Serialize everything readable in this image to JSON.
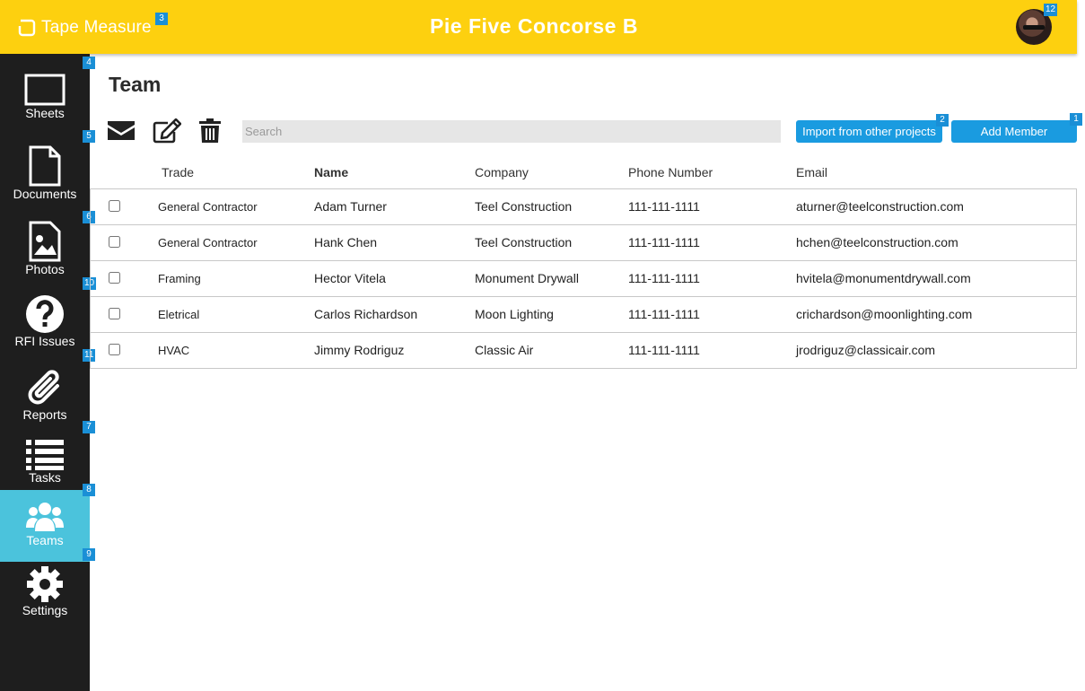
{
  "header": {
    "logo_text": "Tape Measure",
    "project_title": "Pie Five Concorse B",
    "brand_color": "#fdd00f"
  },
  "badges": {
    "add_member": "1",
    "import": "2",
    "logo": "3",
    "sidebar_top": "4",
    "toolbar": "5",
    "row_one": "6",
    "reports": "7",
    "teams": "8",
    "settings": "9",
    "row_three": "10",
    "row_five": "11",
    "avatar": "12"
  },
  "sidebar": {
    "items": [
      {
        "label": "Sheets",
        "icon": "sheet-icon"
      },
      {
        "label": "Documents",
        "icon": "document-icon"
      },
      {
        "label": "Photos",
        "icon": "photo-icon"
      },
      {
        "label": "RFI Issues",
        "icon": "question-icon"
      },
      {
        "label": "Reports",
        "icon": "paperclip-icon"
      },
      {
        "label": "Tasks",
        "icon": "list-icon"
      },
      {
        "label": "Teams",
        "icon": "users-icon",
        "active": true
      },
      {
        "label": "Settings",
        "icon": "gear-icon"
      }
    ],
    "active_color": "#4bc3dc"
  },
  "page": {
    "title": "Team",
    "search_placeholder": "Search",
    "import_label": "Import from other projects",
    "add_member_label": "Add Member",
    "accent_color": "#1a9be0"
  },
  "table": {
    "columns": [
      "Trade",
      "Name",
      "Company",
      "Phone Number",
      "Email"
    ],
    "rows": [
      {
        "trade": "General Contractor",
        "name": "Adam Turner",
        "company": "Teel Construction",
        "phone": "111-111-1111",
        "email": "aturner@teelconstruction.com"
      },
      {
        "trade": "General Contractor",
        "name": "Hank Chen",
        "company": "Teel Construction",
        "phone": "111-111-1111",
        "email": "hchen@teelconstruction.com"
      },
      {
        "trade": "Framing",
        "name": "Hector Vitela",
        "company": "Monument Drywall",
        "phone": "111-111-1111",
        "email": "hvitela@monumentdrywall.com"
      },
      {
        "trade": "Eletrical",
        "name": "Carlos Richardson",
        "company": "Moon Lighting",
        "phone": "111-111-1111",
        "email": "crichardson@moonlighting.com"
      },
      {
        "trade": "HVAC",
        "name": "Jimmy Rodriguz",
        "company": "Classic Air",
        "phone": "111-111-1111",
        "email": "jrodriguz@classicair.com"
      }
    ]
  }
}
